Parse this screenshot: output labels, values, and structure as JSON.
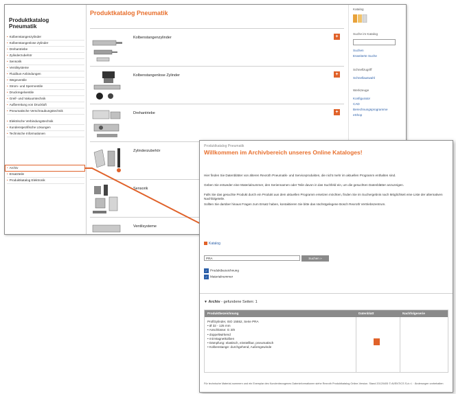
{
  "catalog": {
    "sidebar_title": "Produktkatalog Pneumatik",
    "main_title": "Produktkatalog Pneumatik",
    "sidebar_items": [
      "Kolbenstangenzylinder",
      "Kolbenstangenlose Zylinder",
      "Drehantriebe",
      "Zylinderzubehör",
      "Sensorik",
      "Ventilsysteme",
      "Fluidbus-Anbindungen",
      "Wegeventile",
      "Strom- und Sperrventile",
      "Druckregelventile",
      "Greif- und Vakuumtechnik",
      "Aufbereitung von Druckluft",
      "Pneumatische Verschraubungstechnik",
      "Elektrische Verbindungstechnik",
      "Kundenspezifische Lösungen",
      "Technische Informationen",
      "Archiv",
      "Ersatzteile",
      "Produktkatalog Elektronik"
    ],
    "products": [
      {
        "label": "Kolbenstangenzylinder",
        "plus": "+"
      },
      {
        "label": "Kolbenstangenlose Zylinder",
        "plus": "+"
      },
      {
        "label": "Drehantriebe",
        "plus": "+"
      },
      {
        "label": "Zylinderzubehör",
        "plus": "+"
      },
      {
        "label": "Sensorik",
        "plus": "+"
      },
      {
        "label": "Ventilsysteme",
        "plus": "+"
      }
    ],
    "right": {
      "katalog_label": "Katalog",
      "suche_label": "Suche im Katalog",
      "link1": "Suchen",
      "link2": "Erweiterte Suche",
      "schnell_label": "Schnellzugriff",
      "link3": "Schnellauswahl",
      "werkzeuge_label": "Werkzeuge",
      "link4": "Konfigurator",
      "link5": "CAD",
      "link6": "Berechnungsprogramme",
      "link7": "eShop"
    }
  },
  "archive": {
    "breadcrumb": "Produktkatalog Pneumatik",
    "title": "Willkommen im Archivbereich unseres Online Kataloges!",
    "para1": "Hier finden Sie Datenblätter von älteren Rexroth Pneumatik- und Serviceprodukten, die nicht mehr im aktuellen Programm enthalten sind.",
    "para2": "Geben Sie entweder eine Materialnummer, den Seriennamen oder Teile davon in das Suchfeld ein, um die gesuchten Datenblätter anzuzeigen.",
    "para3": "Falls Sie das gesuchte Produkt durch ein Produkt aus dem aktuellen Programm ersetzen möchten, finden Sie im Suchergebnis nach Möglichkeit eine Liste der alternativen Nachfolgeteile.",
    "para4": "Sollten Sie darüber hinaus Fragen zum Ersatz haben, kontaktieren Sie bitte das nächstgelegene Bosch Rexroth Vertriebszentrum.",
    "katalog_link": "Katalog",
    "search_value": "PRA",
    "search_button": "Suchen »",
    "check1": "Produktbezeichnung",
    "check2": "Materialnummer",
    "section_label": "Archiv",
    "section_count": " - gefundene Seiten: 1",
    "table_headers": [
      "Produktbezeichnung",
      "Datenblatt",
      "Nachfolgeserie"
    ],
    "product_lines": [
      "Profilzylinder, ISO 15552, Serie PRA",
      "• Ø 32 - 125 mm",
      "• Anschlüsse: G 3/8",
      "• doppeltwirkend",
      "• mit Magnetkolben",
      "• Dämpfung: elastisch, einstellbar, pneumatisch",
      "• Kolbenstange: durchgehend, Außengewinde"
    ],
    "footer": "Für technische Material-nummern und ein Exemplar des Kundenbezogenes Dateninformationen siehe Rexroth Produktkatalog Online-Version. Stand 20120405 © AVENTICS S.à r.l. · Änderungen vorbehalten"
  }
}
